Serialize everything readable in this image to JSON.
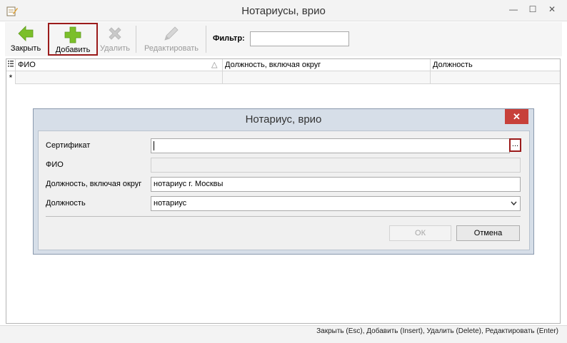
{
  "window": {
    "title": "Нотариусы, врио",
    "minimize_glyph": "—",
    "maximize_glyph": "☐",
    "close_glyph": "✕"
  },
  "toolbar": {
    "close_label": "Закрыть",
    "add_label": "Добавить",
    "delete_label": "Удалить",
    "edit_label": "Редактировать",
    "filter_label": "Фильтр:",
    "filter_value": ""
  },
  "grid": {
    "columns": [
      "ФИО",
      "Должность, включая округ",
      "Должность"
    ],
    "sort_indicator": "△",
    "new_row_marker": "*"
  },
  "dialog": {
    "title": "Нотариус, врио",
    "close_glyph": "✕",
    "fields": {
      "certificate_label": "Сертификат",
      "certificate_value": "",
      "browse_label": "...",
      "fio_label": "ФИО",
      "fio_value": "",
      "position_district_label": "Должность, включая округ",
      "position_district_value": "нотариус г. Москвы",
      "position_label": "Должность",
      "position_value": "нотариус"
    },
    "ok_label": "ОК",
    "cancel_label": "Отмена"
  },
  "statusbar": {
    "hint": "Закрыть (Esc), Добавить (Insert), Удалить (Delete), Редактировать (Enter)"
  },
  "colors": {
    "accent_red": "#9b1b1b",
    "add_green": "#7bbf2a",
    "close_red": "#c7403a"
  }
}
